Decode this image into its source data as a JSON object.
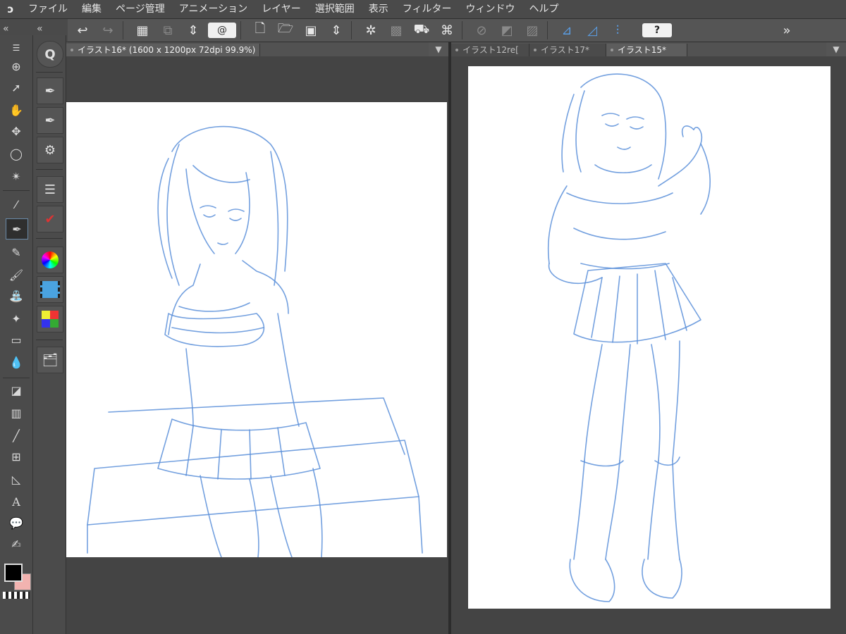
{
  "menubar": {
    "items": [
      "ファイル",
      "編集",
      "ページ管理",
      "アニメーション",
      "レイヤー",
      "選択範囲",
      "表示",
      "フィルター",
      "ウィンドウ",
      "ヘルプ"
    ]
  },
  "left_view": {
    "tab_title": "イラスト16* (1600 x 1200px 72dpi 99.9%)"
  },
  "right_view": {
    "tabs": [
      "イラスト12re[",
      "イラスト17*",
      "イラスト15*"
    ],
    "active_tab": 2
  },
  "colors": {
    "main_color": "#000000",
    "sub_color": "#f2b3b0",
    "sketch_stroke": "#5b8fd9"
  },
  "icons": {
    "help": "?",
    "quick_access": "Q",
    "text_tool": "A"
  }
}
